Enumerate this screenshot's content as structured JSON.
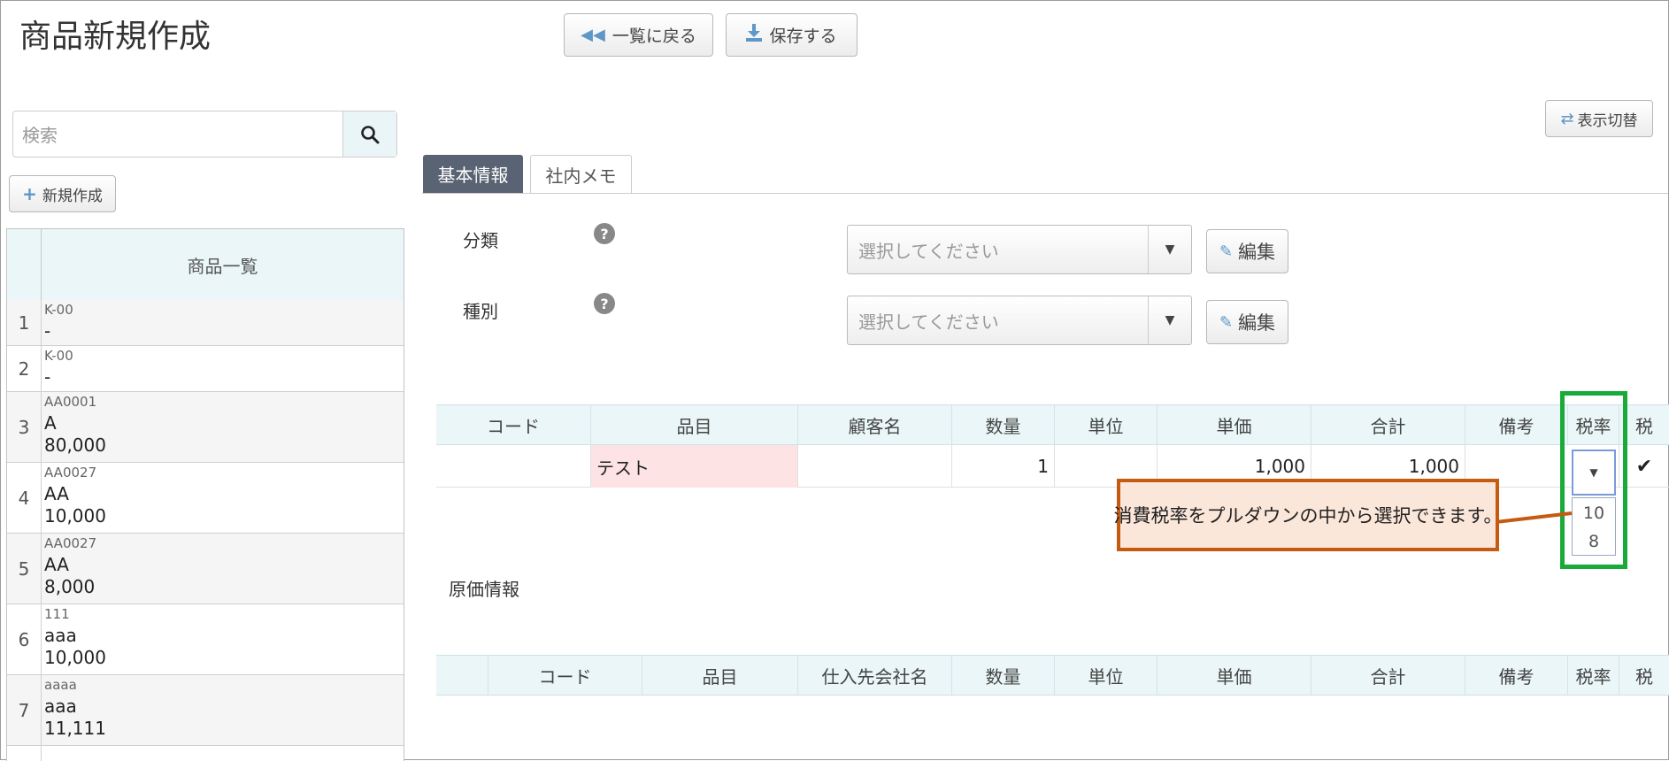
{
  "page": {
    "title": "商品新規作成"
  },
  "toolbar": {
    "back_label": "一覧に戻る",
    "save_label": "保存する",
    "toggle_view_label": "表示切替"
  },
  "sidebar": {
    "search_placeholder": "検索",
    "new_label": "新規作成",
    "list_header": "商品一覧",
    "items": [
      {
        "num": "1",
        "code": "K-00",
        "name": "-",
        "price": ""
      },
      {
        "num": "2",
        "code": "K-00",
        "name": "-",
        "price": ""
      },
      {
        "num": "3",
        "code": "AA0001",
        "name": "A",
        "price": "80,000"
      },
      {
        "num": "4",
        "code": "AA0027",
        "name": "AA",
        "price": "10,000"
      },
      {
        "num": "5",
        "code": "AA0027",
        "name": "AA",
        "price": "8,000"
      },
      {
        "num": "6",
        "code": "111",
        "name": "aaa",
        "price": "10,000"
      },
      {
        "num": "7",
        "code": "aaaa",
        "name": "aaa",
        "price": "11,111"
      }
    ]
  },
  "tabs": [
    {
      "label": "基本情報",
      "active": true
    },
    {
      "label": "社内メモ",
      "active": false
    }
  ],
  "form": {
    "category_label": "分類",
    "type_label": "種別",
    "select_placeholder": "選択してください",
    "edit_label": "編集"
  },
  "detail_table": {
    "headers": [
      "コード",
      "品目",
      "顧客名",
      "数量",
      "単位",
      "単価",
      "合計",
      "備考",
      "税率",
      "税"
    ],
    "row": {
      "code": "",
      "item": "テスト",
      "customer": "",
      "qty": "1",
      "unit": "",
      "unit_price": "1,000",
      "total": "1,000",
      "note": "",
      "tax_rate": "",
      "tax_check": "✔"
    },
    "tax_rate_options": [
      "10",
      "8"
    ]
  },
  "callout_text": "消費税率をプルダウンの中から選択できます。",
  "cost_section": {
    "label": "原価情報",
    "headers": [
      "",
      "コード",
      "品目",
      "仕入先会社名",
      "数量",
      "単位",
      "単価",
      "合計",
      "備考",
      "税率",
      "税"
    ]
  },
  "colors": {
    "tab_active": "#5a6373",
    "header_bg": "#eaf6f7",
    "item_highlight": "#fde3e3",
    "callout_border": "#c55a11",
    "callout_bg": "#fbe6da",
    "focus_box": "#1aaa3a"
  }
}
